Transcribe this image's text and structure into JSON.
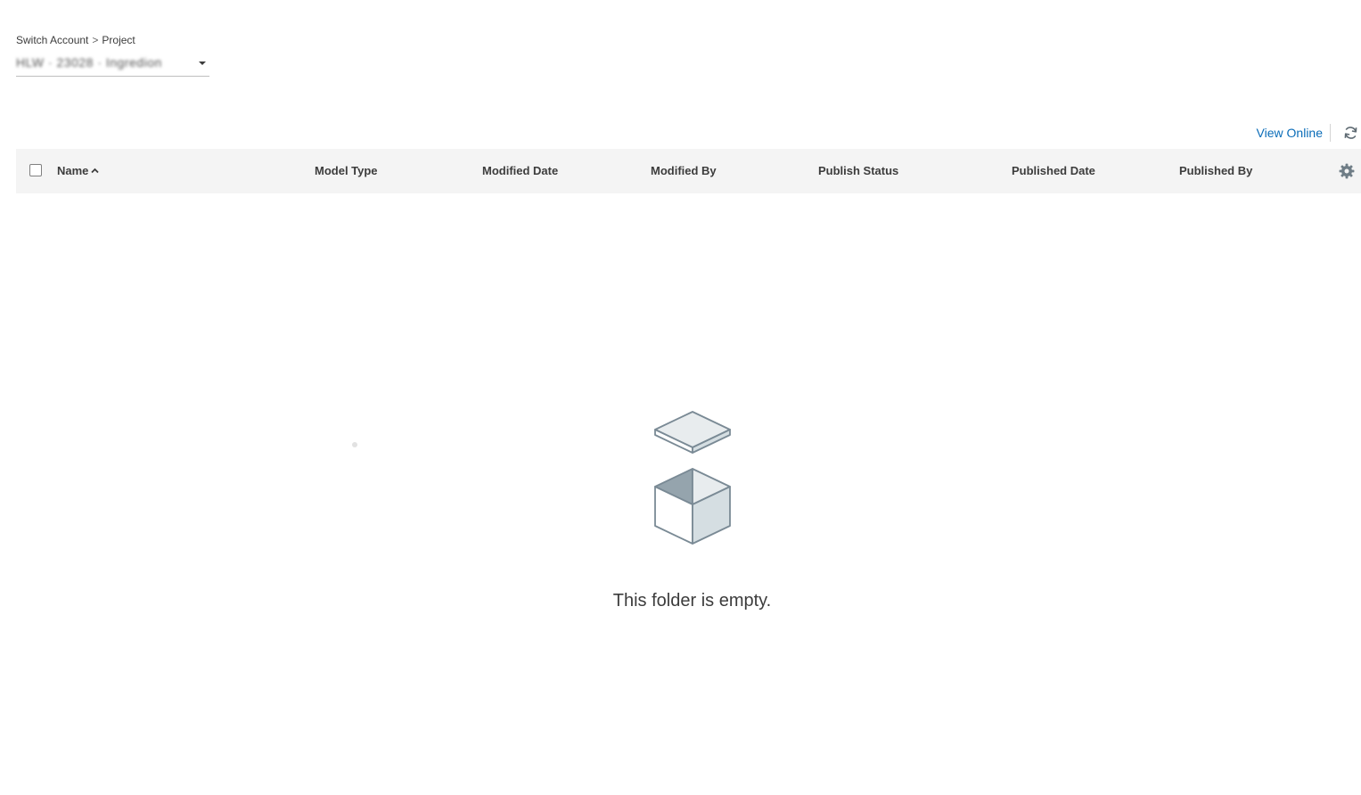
{
  "breadcrumb": {
    "account": "Switch Account",
    "separator": ">",
    "project": "Project"
  },
  "project_select": {
    "value": "HLW · 23028 · Ingredion"
  },
  "toolbar": {
    "view_online_label": "View Online",
    "refresh_icon": "refresh-icon"
  },
  "table": {
    "columns": {
      "name": "Name",
      "model_type": "Model Type",
      "modified_date": "Modified Date",
      "modified_by": "Modified By",
      "publish_status": "Publish Status",
      "published_date": "Published Date",
      "published_by": "Published By"
    },
    "sort_icon": "chevron-up-icon",
    "settings_icon": "gear-icon"
  },
  "empty_state": {
    "icon": "open-box-icon",
    "message": "This folder is empty."
  },
  "colors": {
    "link": "#0a6cb8",
    "header_bg": "#f4f4f4",
    "icon_gray": "#7a8a95"
  }
}
